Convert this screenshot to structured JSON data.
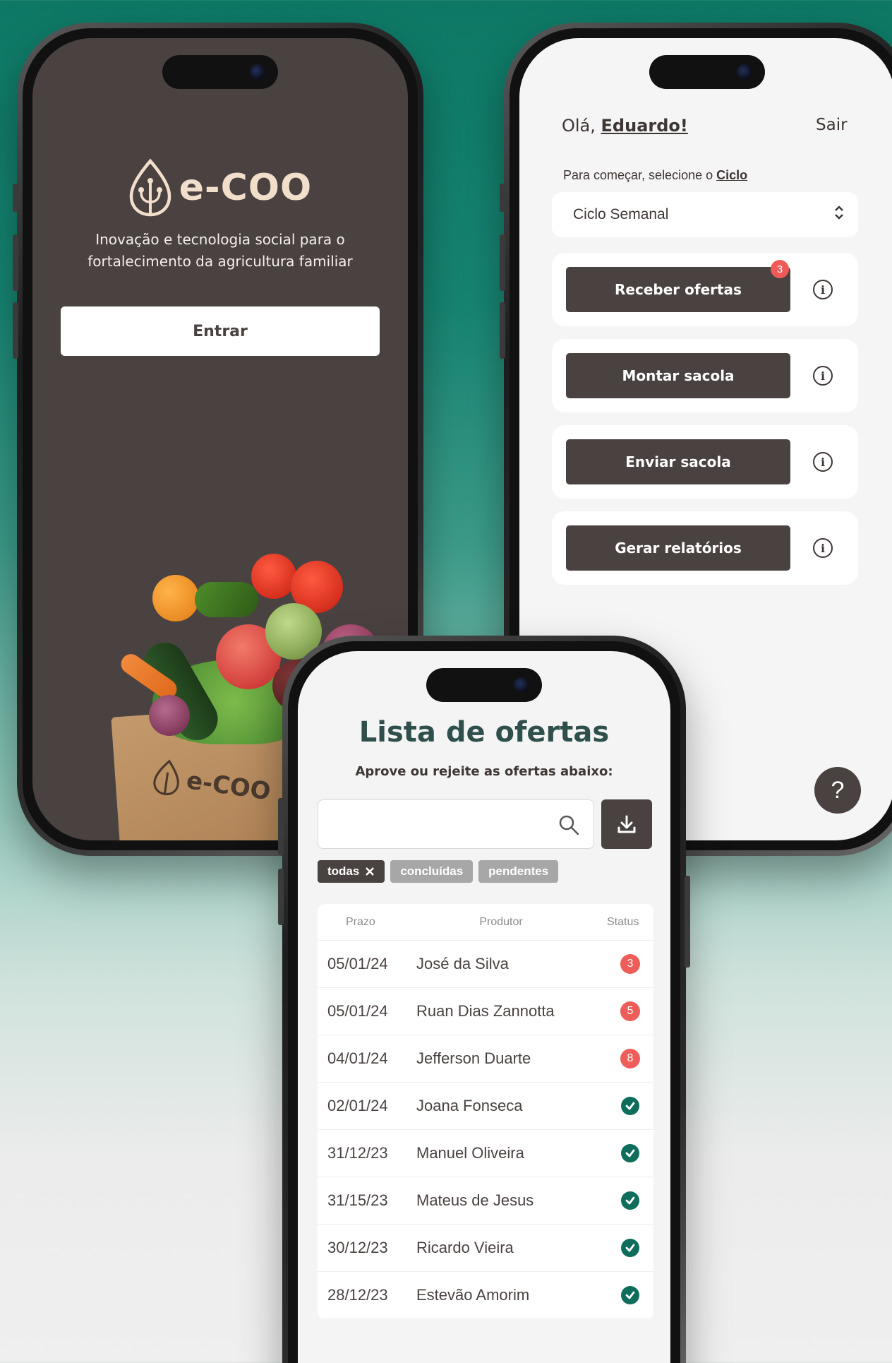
{
  "brand": {
    "name": "e-COO",
    "bag_name": "e-COO"
  },
  "login": {
    "tagline": "Inovação e tecnologia social para o fortalecimento da agricultura familiar",
    "enter_label": "Entrar"
  },
  "home": {
    "greeting_prefix": "Olá, ",
    "user_name": "Eduardo!",
    "logout_label": "Sair",
    "cycle_hint_prefix": "Para começar, selecione o ",
    "cycle_hint_link": "Ciclo",
    "cycle_selected": "Ciclo Semanal",
    "actions": [
      {
        "label": "Receber ofertas",
        "badge": "3"
      },
      {
        "label": "Montar sacola"
      },
      {
        "label": "Enviar sacola"
      },
      {
        "label": "Gerar relatórios"
      }
    ],
    "help_label": "?"
  },
  "offers": {
    "title": "Lista de ofertas",
    "subtitle": "Aprove ou rejeite as ofertas abaixo:",
    "search_placeholder": "",
    "filters": [
      {
        "label": "todas",
        "active": true
      },
      {
        "label": "concluídas",
        "active": false
      },
      {
        "label": "pendentes",
        "active": false
      }
    ],
    "columns": [
      "Prazo",
      "Produtor",
      "Status"
    ],
    "rows": [
      {
        "prazo": "05/01/24",
        "produtor": "José da Silva",
        "status": "3"
      },
      {
        "prazo": "05/01/24",
        "produtor": "Ruan Dias Zannotta",
        "status": "5"
      },
      {
        "prazo": "04/01/24",
        "produtor": "Jefferson Duarte",
        "status": "8"
      },
      {
        "prazo": "02/01/24",
        "produtor": "Joana Fonseca",
        "status": "ok"
      },
      {
        "prazo": "31/12/23",
        "produtor": "Manuel Oliveira",
        "status": "ok"
      },
      {
        "prazo": "31/15/23",
        "produtor": "Mateus de Jesus",
        "status": "ok"
      },
      {
        "prazo": "30/12/23",
        "produtor": "Ricardo Vieira",
        "status": "ok"
      },
      {
        "prazo": "28/12/23",
        "produtor": "Estevão Amorim",
        "status": "ok"
      }
    ]
  },
  "colors": {
    "primary": "#4a4240",
    "accent_green": "#0e6e5b",
    "alert_red": "#ee5d5a",
    "logo_cream": "#f2dfcb"
  }
}
